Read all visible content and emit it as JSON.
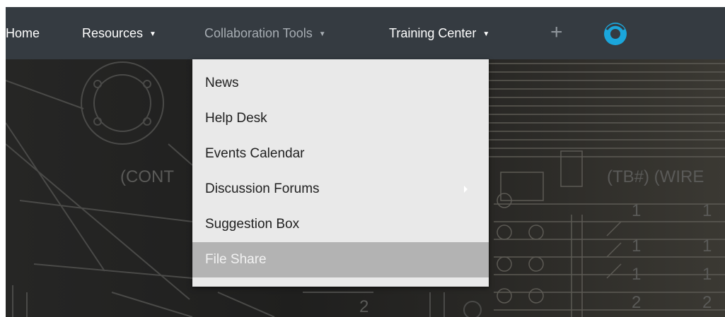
{
  "nav": {
    "home": "Home",
    "resources": "Resources",
    "collaboration": "Collaboration Tools",
    "training": "Training Center",
    "caret": "▼",
    "plus": "+",
    "logo_icon": "support-headset-icon"
  },
  "dropdown": {
    "items": [
      {
        "label": "News"
      },
      {
        "label": "Help Desk"
      },
      {
        "label": "Events Calendar"
      },
      {
        "label": "Discussion Forums"
      },
      {
        "label": "Suggestion Box"
      },
      {
        "label": "File Share"
      }
    ]
  },
  "background": {
    "label_left": "(CONT",
    "label_right": "(TB#) (WIRE",
    "numbers": [
      "1",
      "1",
      "1",
      "1",
      "1",
      "1",
      "2",
      "2",
      "2"
    ]
  },
  "colors": {
    "navbar": "#353b41",
    "dropdown": "#e9e9e9",
    "active_item": "#b3b3b3",
    "accent": "#1ba6db"
  }
}
